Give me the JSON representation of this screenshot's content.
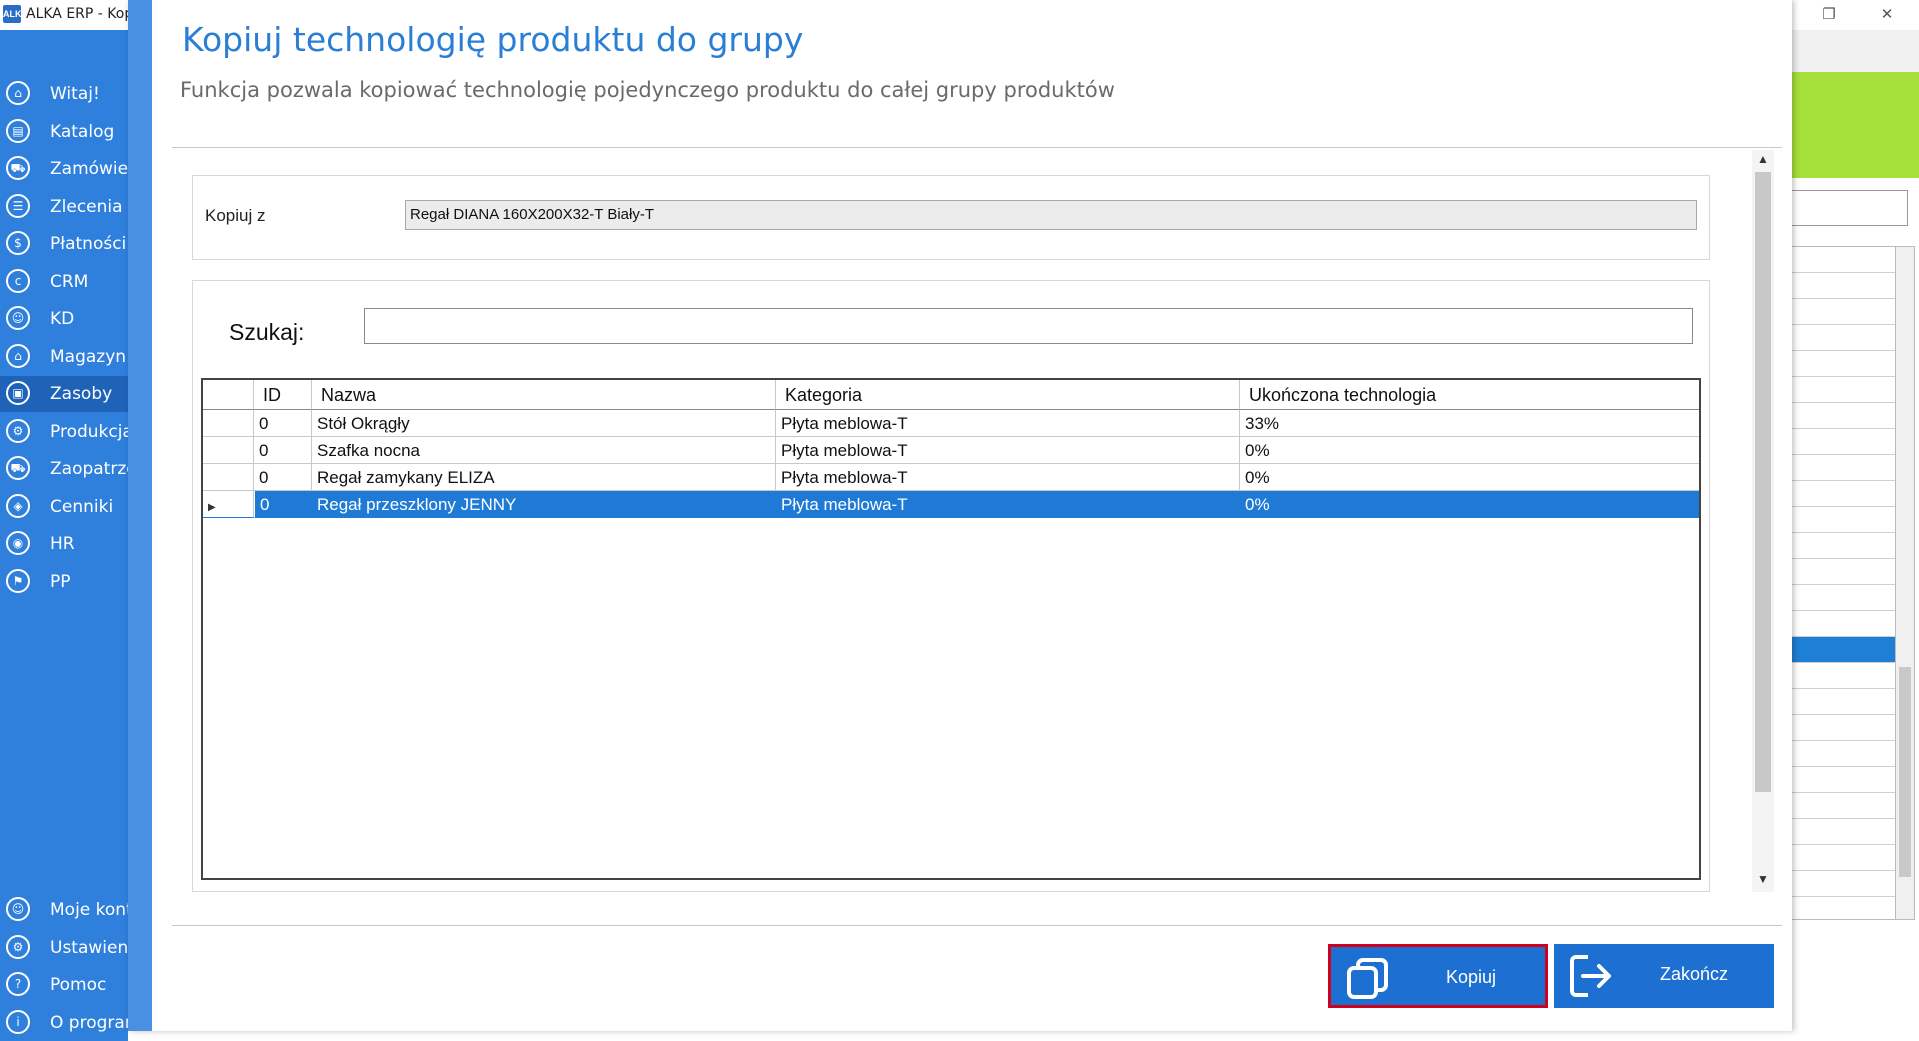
{
  "window": {
    "title": "ALKA ERP - Kop",
    "restore_symbol": "❐",
    "close_symbol": "✕"
  },
  "sidebar": {
    "items": [
      {
        "label": "Witaj!",
        "icon": "home-icon",
        "glyph": "⌂"
      },
      {
        "label": "Katalog",
        "icon": "book-icon",
        "glyph": "▤"
      },
      {
        "label": "Zamówienia",
        "icon": "cart-icon",
        "glyph": "⛟"
      },
      {
        "label": "Zlecenia",
        "icon": "list-icon",
        "glyph": "☰"
      },
      {
        "label": "Płatności",
        "icon": "dollar-icon",
        "glyph": "$"
      },
      {
        "label": "CRM",
        "icon": "crm-icon",
        "glyph": "c"
      },
      {
        "label": "KD",
        "icon": "person-icon",
        "glyph": "☺"
      },
      {
        "label": "Magazyn",
        "icon": "warehouse-icon",
        "glyph": "⌂"
      },
      {
        "label": "Zasoby",
        "icon": "resources-icon",
        "glyph": "▣"
      },
      {
        "label": "Produkcja",
        "icon": "production-icon",
        "glyph": "⚙"
      },
      {
        "label": "Zaopatrzenie",
        "icon": "truck-icon",
        "glyph": "⛟"
      },
      {
        "label": "Cenniki",
        "icon": "tag-icon",
        "glyph": "◈"
      },
      {
        "label": "HR",
        "icon": "hr-icon",
        "glyph": "◉"
      },
      {
        "label": "PP",
        "icon": "pp-icon",
        "glyph": "⚑"
      }
    ],
    "bottom_items": [
      {
        "label": "Moje konto",
        "icon": "account-icon",
        "glyph": "☺"
      },
      {
        "label": "Ustawienia",
        "icon": "settings-icon",
        "glyph": "⚙"
      },
      {
        "label": "Pomoc",
        "icon": "help-icon",
        "glyph": "?"
      },
      {
        "label": "O programie",
        "icon": "info-icon",
        "glyph": "i"
      }
    ],
    "active_index": 8,
    "color": "#2f7fdc"
  },
  "dialog": {
    "title": "Kopiuj technologię produktu do grupy",
    "subtitle": "Funkcja pozwala kopiować technologię pojedynczego produktu do całej grupy produktów",
    "copy_from": {
      "label": "Kopiuj z",
      "value": "Regał DIANA 160X200X32-T Biały-T"
    },
    "search": {
      "label": "Szukaj:",
      "value": ""
    },
    "table": {
      "columns": [
        "ID",
        "Nazwa",
        "Kategoria",
        "Ukończona technologia"
      ],
      "rows": [
        {
          "id": "0",
          "name": "Stół Okrągły",
          "category": "Płyta meblowa-T",
          "completed": "33%"
        },
        {
          "id": "0",
          "name": "Szafka nocna",
          "category": "Płyta meblowa-T",
          "completed": "0%"
        },
        {
          "id": "0",
          "name": "Regał zamykany ELIZA",
          "category": "Płyta meblowa-T",
          "completed": "0%"
        },
        {
          "id": "0",
          "name": "Regał przeszklony JENNY",
          "category": "Płyta meblowa-T",
          "completed": "0%"
        }
      ],
      "selected_index": 3,
      "selection_color": "#1f7ad6"
    },
    "buttons": {
      "copy_label": "Kopiuj",
      "finish_label": "Zakończ"
    },
    "accent_color": "#2a7fd4"
  },
  "background_window": {
    "accent_green": "#a6e03a"
  }
}
